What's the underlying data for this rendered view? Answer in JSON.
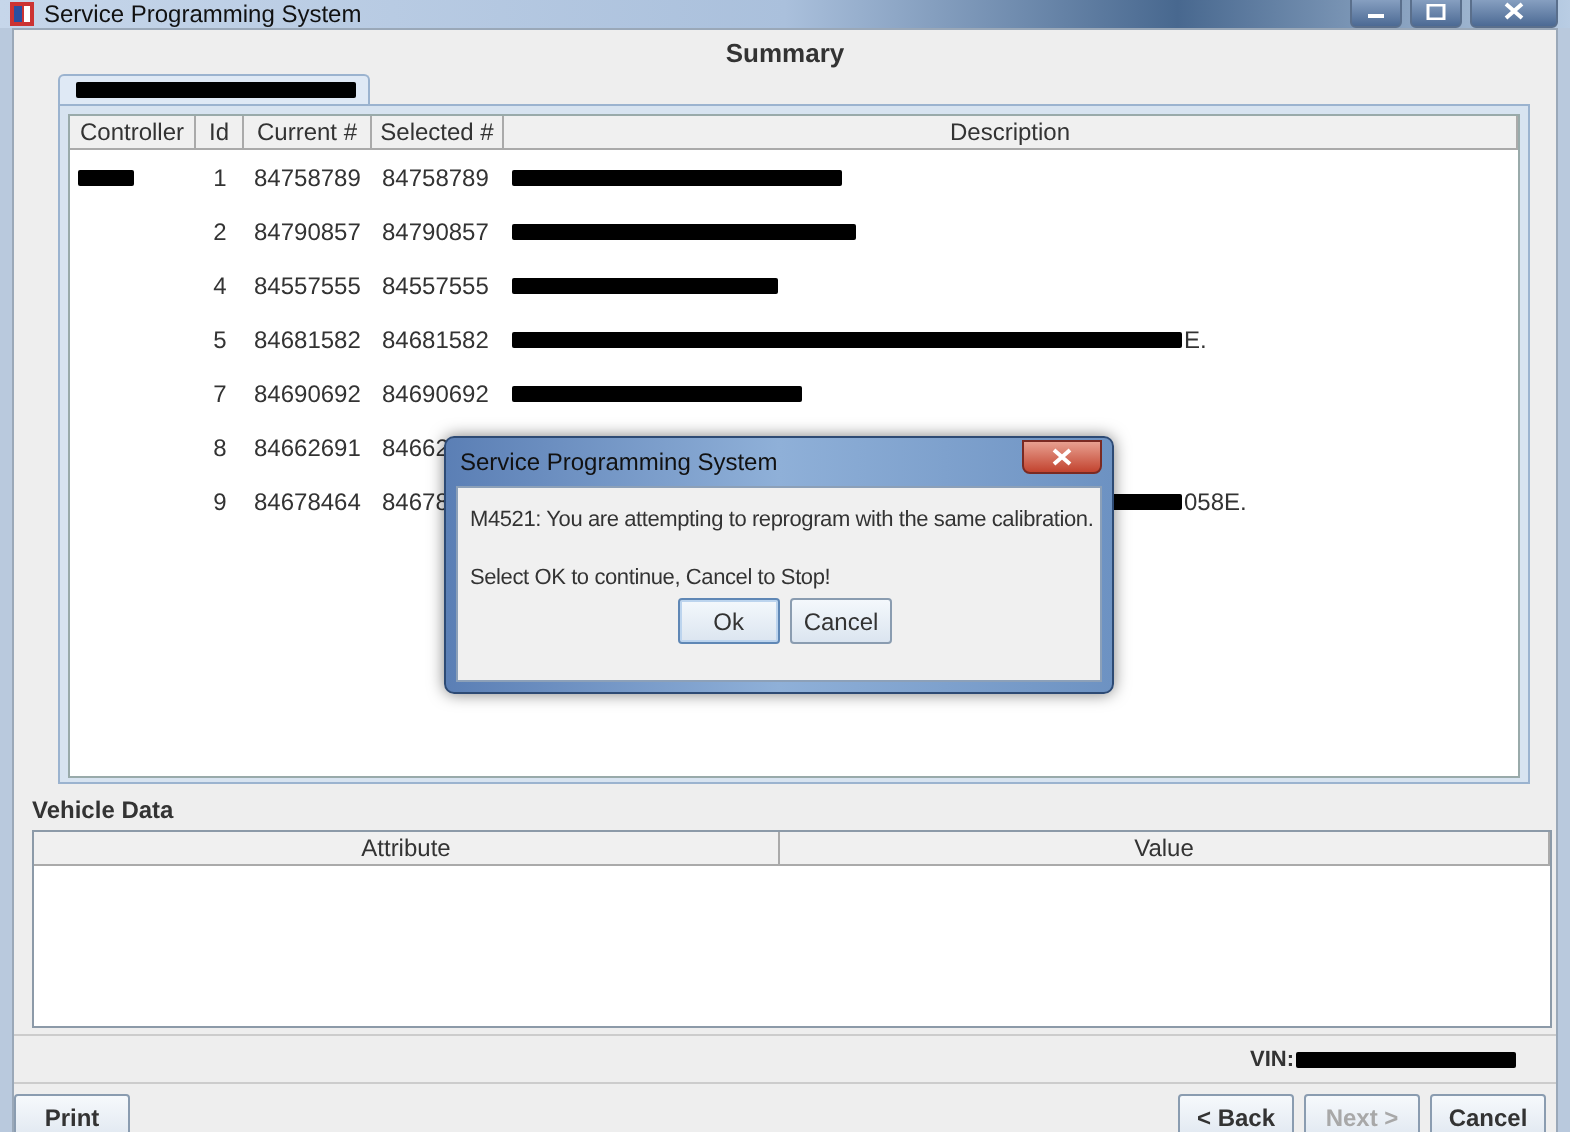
{
  "window": {
    "title": "Service Programming System"
  },
  "heading": "Summary",
  "tabs": [
    {
      "redacted": true,
      "selected": true
    }
  ],
  "table": {
    "columns": [
      "Controller",
      "Id",
      "Current #",
      "Selected #",
      "Description"
    ],
    "rows": [
      {
        "controller": {
          "redacted": true
        },
        "id": "1",
        "current": "84758789",
        "selected_no": "84758789",
        "description": {
          "redacted": true
        }
      },
      {
        "id": "2",
        "current": "84790857",
        "selected_no": "84790857",
        "description": {
          "redacted": true
        }
      },
      {
        "id": "4",
        "current": "84557555",
        "selected_no": "84557555",
        "description": {
          "redacted": true
        }
      },
      {
        "id": "5",
        "current": "84681582",
        "selected_no": "84681582",
        "description": {
          "redacted": true,
          "tail": "E."
        }
      },
      {
        "id": "7",
        "current": "84690692",
        "selected_no": "84690692",
        "description": {
          "redacted": true
        }
      },
      {
        "id": "8",
        "current": "84662691",
        "selected_no": "84662"
      },
      {
        "id": "9",
        "current": "84678464",
        "selected_no": "84678",
        "description": {
          "redacted": true,
          "tail": "058E."
        }
      }
    ]
  },
  "vehicle_data": {
    "label": "Vehicle Data",
    "columns": [
      "Attribute",
      "Value"
    ]
  },
  "vin": {
    "label": "VIN:",
    "redacted": true
  },
  "buttons": [
    {
      "label": "Print",
      "disabled": false
    },
    {
      "label": "< Back",
      "disabled": false
    },
    {
      "label": "Next >",
      "disabled": true
    },
    {
      "label": "Cancel",
      "disabled": false
    }
  ],
  "dialog": {
    "title": "Service Programming System",
    "lines": [
      "M4521: You are attempting to reprogram with the same calibration.",
      "Select OK to continue, Cancel to Stop!"
    ],
    "buttons": [
      {
        "label": "Ok",
        "focused": true
      },
      {
        "label": "Cancel",
        "focused": false
      }
    ]
  }
}
